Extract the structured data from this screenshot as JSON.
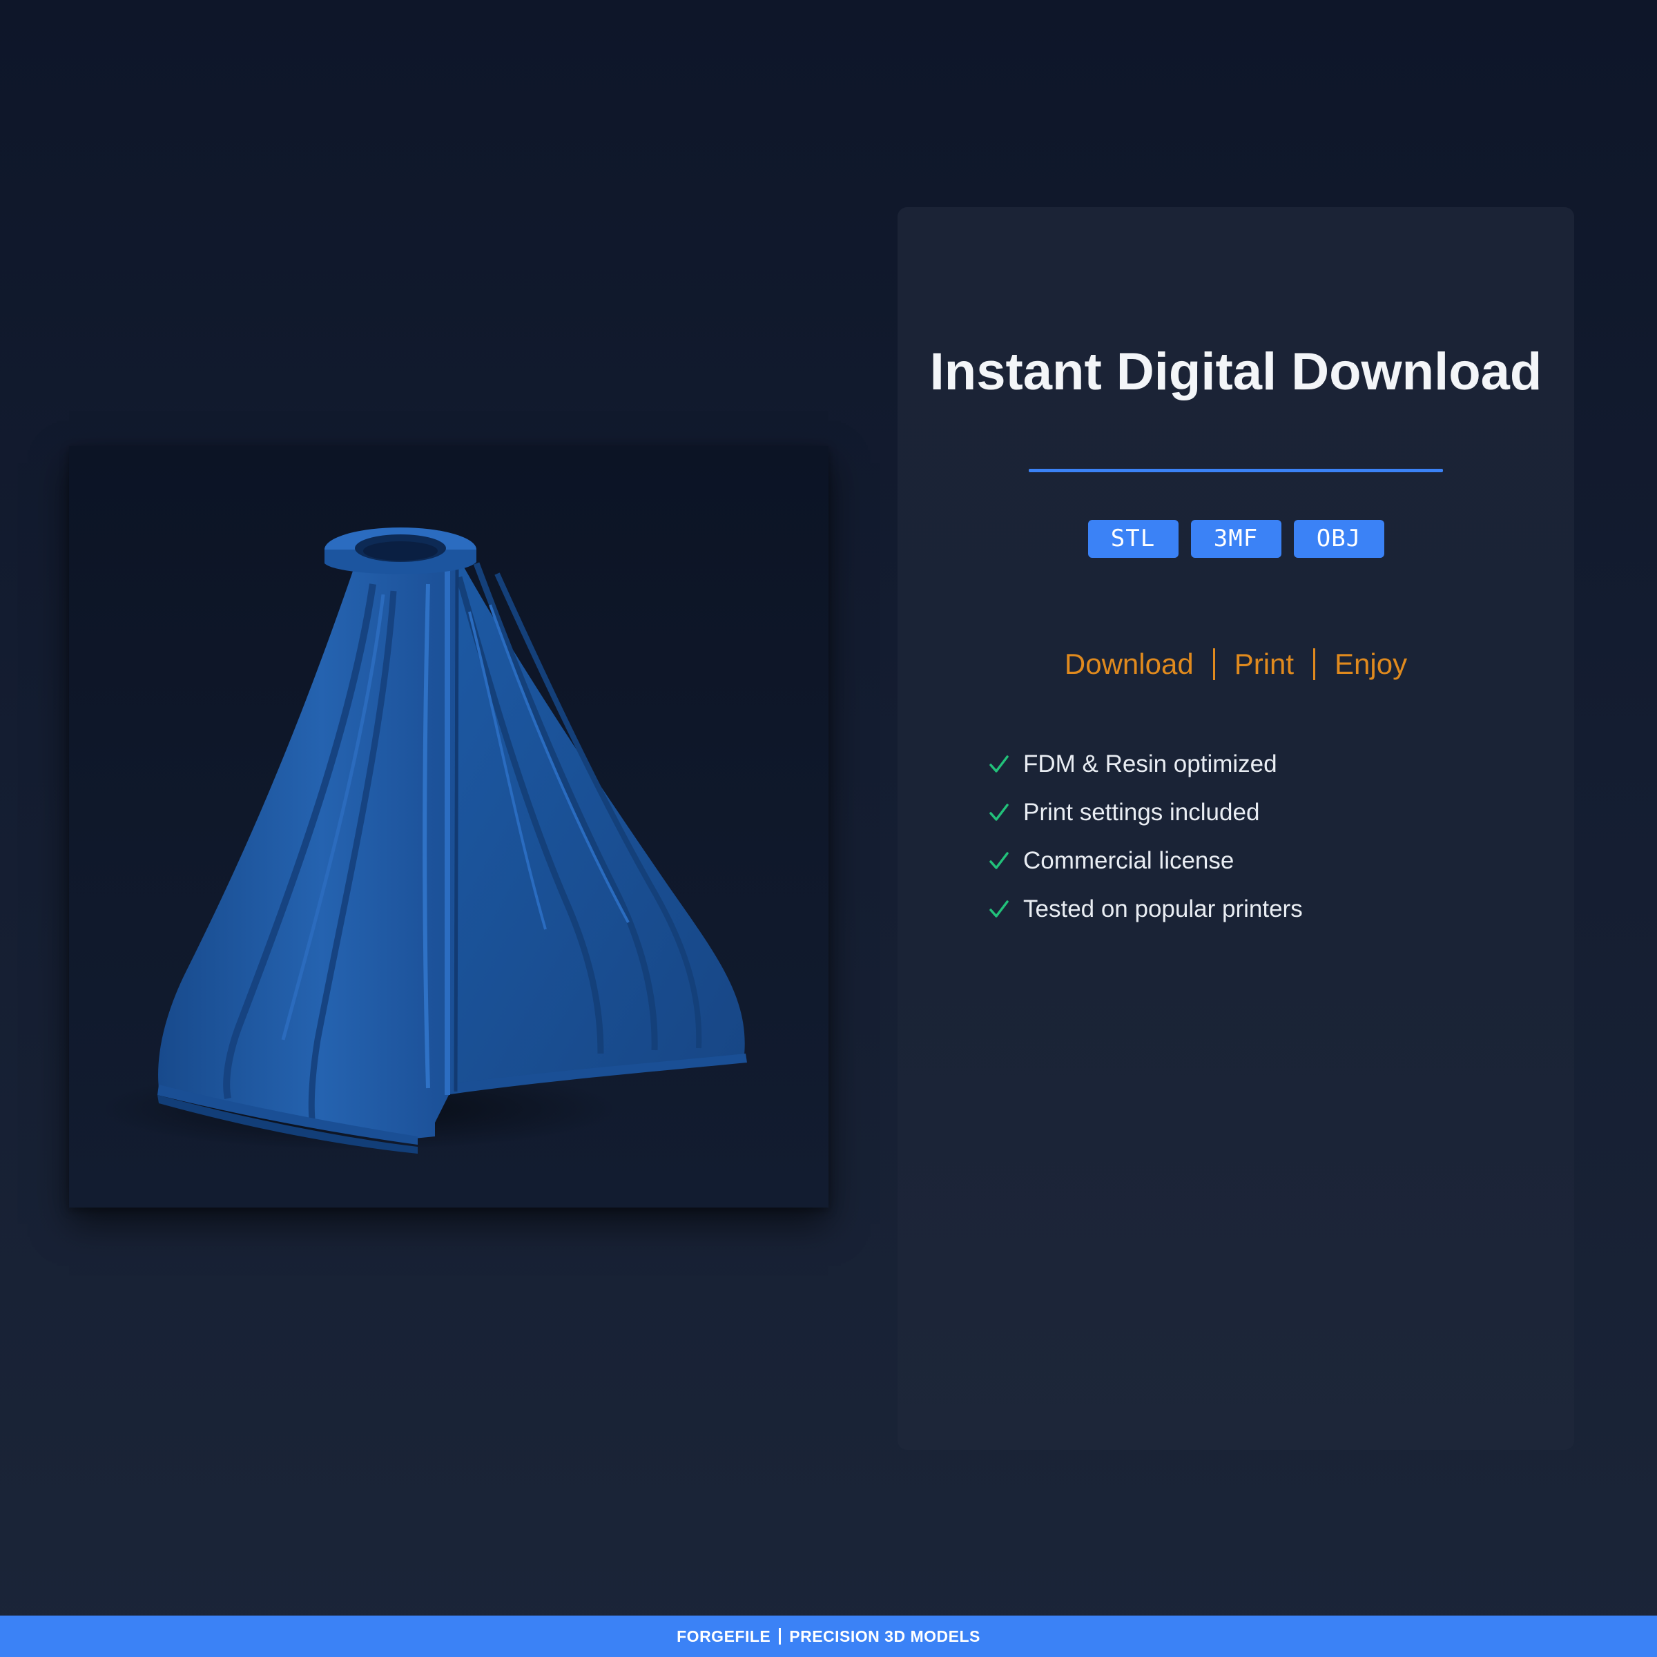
{
  "colors": {
    "accent": "#3b82f6",
    "step_color": "#e08a1e",
    "check_color": "#22c17a",
    "model_blue": "#1f5aa6"
  },
  "product": {
    "image_icon": "blue-3d-printed-model-render"
  },
  "card": {
    "title": "Instant Digital Download",
    "formats": [
      "STL",
      "3MF",
      "OBJ"
    ],
    "steps": [
      "Download",
      "Print",
      "Enjoy"
    ],
    "features": [
      "FDM & Resin optimized",
      "Print settings included",
      "Commercial license",
      "Tested on popular printers"
    ],
    "feature_icon": "check-icon"
  },
  "footer": {
    "brand": "FORGEFILE",
    "tagline": "PRECISION 3D MODELS"
  }
}
